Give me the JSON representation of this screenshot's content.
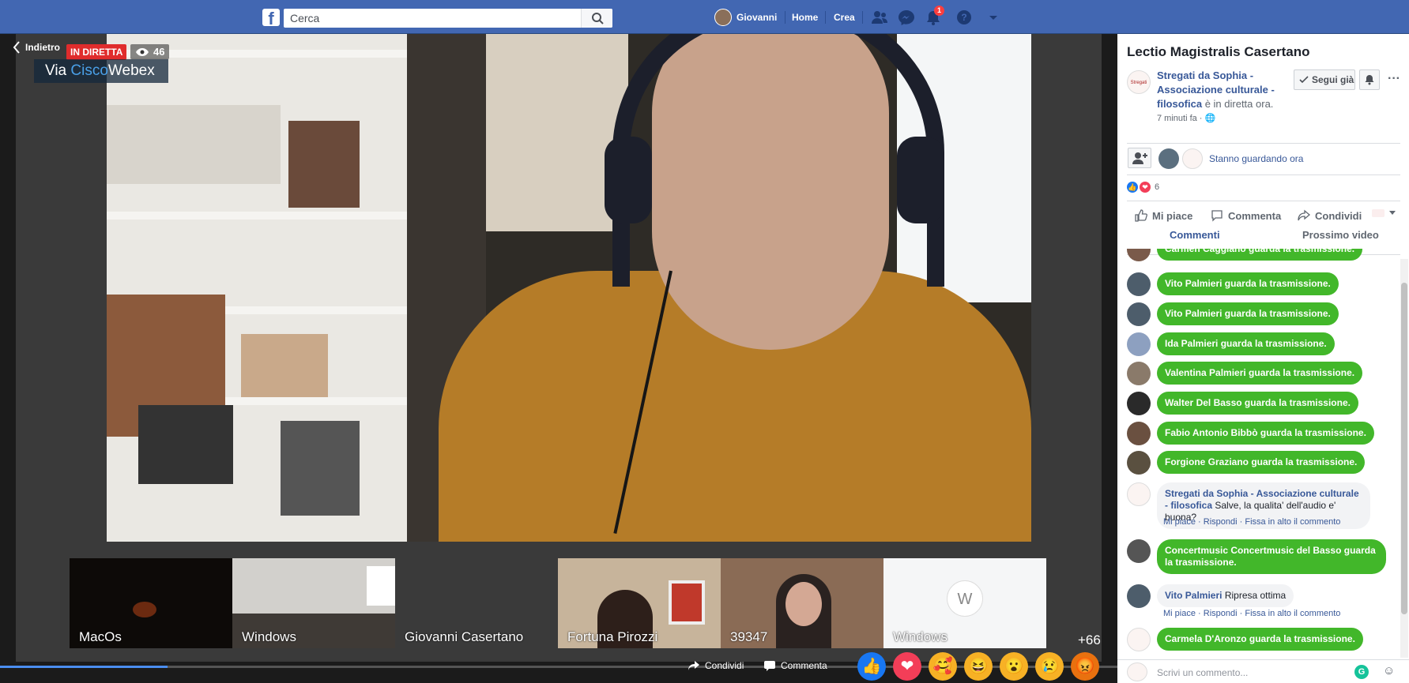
{
  "topbar": {
    "logo": "f",
    "search_placeholder": "Cerca",
    "user_name": "Giovanni",
    "home_label": "Home",
    "create_label": "Crea",
    "notifications_count": "1",
    "brand_color": "#4267b2"
  },
  "video": {
    "back_label": "Indietro",
    "live_label": "IN DIRETTA",
    "viewer_count": "46",
    "webex_prefix": "Via ",
    "webex_cisco": "Cisco",
    "webex_name": "Webex",
    "participants": [
      {
        "label": "MacOs"
      },
      {
        "label": "Windows"
      },
      {
        "label": "Giovanni Casertano"
      },
      {
        "label": "Fortuna Pirozzi"
      },
      {
        "label": "39347"
      },
      {
        "label": "Windows",
        "avatar": "W"
      }
    ],
    "more_participants": "+66",
    "progress_fraction": 0.15,
    "share_label": "Condividi",
    "comment_label": "Commenta"
  },
  "sidebar": {
    "title": "Lectio Magistralis Casertano",
    "page_logo_text": "Stregati da Sophia",
    "page_name": "Stregati da Sophia - Associazione culturale - filosofica",
    "live_suffix": " è in diretta ora.",
    "post_time": "7 minuti fa · ",
    "follow_label": "Segui già",
    "watching_label": "Stanno guardando ora",
    "reaction_count": "6",
    "actions": {
      "like": "Mi piace",
      "comment": "Commenta",
      "share": "Condividi"
    },
    "tabs": {
      "comments": "Commenti",
      "next": "Prossimo video"
    },
    "comments": [
      {
        "type": "join",
        "text": "Carmen Caggiano guarda la trasmissione."
      },
      {
        "type": "join",
        "text": "Vito Palmieri guarda la trasmissione."
      },
      {
        "type": "join",
        "text": "Vito Palmieri guarda la trasmissione."
      },
      {
        "type": "join",
        "text": "Ida Palmieri guarda la trasmissione."
      },
      {
        "type": "join",
        "text": "Valentina Palmieri guarda la trasmissione."
      },
      {
        "type": "join",
        "text": "Walter Del Basso guarda la trasmissione."
      },
      {
        "type": "join",
        "text": "Fabio Antonio Bibbò guarda la trasmissione."
      },
      {
        "type": "join",
        "text": "Forgione Graziano guarda la trasmissione."
      },
      {
        "type": "comment",
        "author": "Stregati da Sophia - Associazione culturale - filosofica",
        "text": " Salve, la qualita' dell'audio e' buona?",
        "like": "Mi piace",
        "reply": "Rispondi",
        "pin": "Fissa in alto il commento"
      },
      {
        "type": "join",
        "text": "Concertmusic Concertmusic del Basso guarda la trasmissione."
      },
      {
        "type": "comment",
        "author": "Vito Palmieri",
        "text": " Ripresa ottima",
        "like": "Mi piace",
        "reply": "Rispondi",
        "pin": "Fissa in alto il commento"
      },
      {
        "type": "join",
        "text": "Carmela D'Aronzo guarda la trasmissione."
      }
    ],
    "compose_placeholder": "Scrivi un commento..."
  }
}
